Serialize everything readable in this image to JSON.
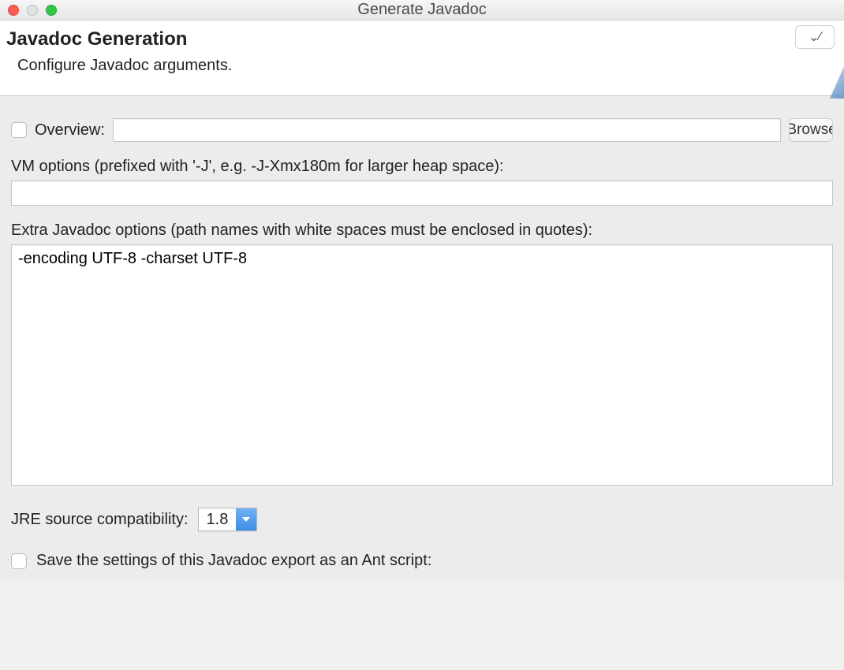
{
  "window": {
    "title": "Generate Javadoc"
  },
  "header": {
    "title": "Javadoc Generation",
    "description": "Configure Javadoc arguments."
  },
  "overview": {
    "label": "Overview:",
    "value": "",
    "checked": false,
    "browse_label": "Browse..."
  },
  "vm_options": {
    "label": "VM options (prefixed with '-J', e.g. -J-Xmx180m for larger heap space):",
    "value": ""
  },
  "extra_options": {
    "label": "Extra Javadoc options (path names with white spaces must be enclosed in quotes):",
    "value": "-encoding UTF-8 -charset UTF-8"
  },
  "jre": {
    "label": "JRE source compatibility:",
    "selected": "1.8"
  },
  "save_ant": {
    "label": "Save the settings of this Javadoc export as an Ant script:",
    "checked": false
  }
}
